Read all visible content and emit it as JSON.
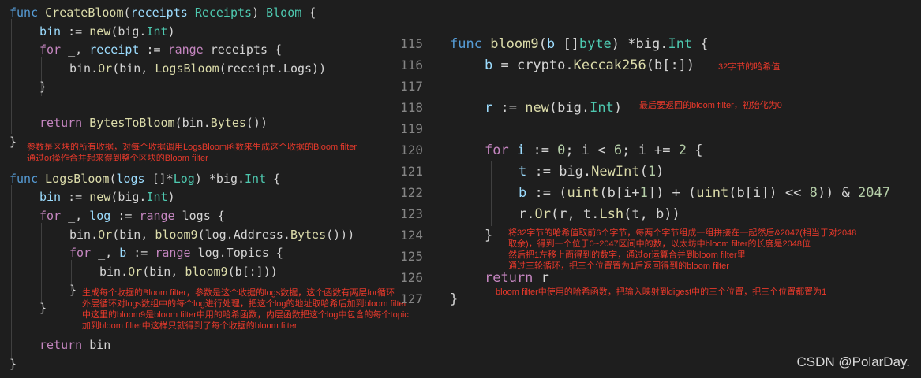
{
  "left_code": {
    "l1": {
      "kw": "func",
      "fn": "CreateBloom",
      "p1": "(",
      "vr": "receipts",
      "sp": " ",
      "ty": "Receipts",
      "p2": ") ",
      "ty2": "Bloom",
      "p3": " {"
    },
    "l2": {
      "vr": "bin",
      "op": " := ",
      "fn": "new",
      "p": "(big.",
      "ty": "Int",
      "end": ")"
    },
    "l3": {
      "ctl": "for",
      "a": " _, ",
      "vr": "receipt",
      "op": " := ",
      "ctl2": "range",
      "b": " receipts {"
    },
    "l4": {
      "a": "bin.",
      "fn": "Or",
      "b": "(bin, ",
      "fn2": "LogsBloom",
      "c": "(receipt.Logs))"
    },
    "l5": "}",
    "l6": {
      "ctl": "return",
      "sp": " ",
      "fn": "BytesToBloom",
      "a": "(bin.",
      "fn2": "Bytes",
      "b": "())"
    },
    "l7": "}",
    "l8": {
      "kw": "func",
      "fn": "LogsBloom",
      "p1": "(",
      "vr": "logs",
      "sp": " []*",
      "ty": "Log",
      "p2": ") *big.",
      "ty2": "Int",
      "p3": " {"
    },
    "l9": {
      "vr": "bin",
      "op": " := ",
      "fn": "new",
      "p": "(big.",
      "ty": "Int",
      "end": ")"
    },
    "l10": {
      "ctl": "for",
      "a": " _, ",
      "vr": "log",
      "op": " := ",
      "ctl2": "range",
      "b": " logs {"
    },
    "l11": {
      "a": "bin.",
      "fn": "Or",
      "b": "(bin, ",
      "fn2": "bloom9",
      "c": "(log.Address.",
      "fn3": "Bytes",
      "d": "()))"
    },
    "l12": {
      "ctl": "for",
      "a": " _, ",
      "vr": "b",
      "op": " := ",
      "ctl2": "range",
      "b": " log.Topics {"
    },
    "l13": {
      "a": "bin.",
      "fn": "Or",
      "b": "(bin, ",
      "fn2": "bloom9",
      "c": "(b[:]))"
    },
    "l14": "}",
    "l15": "}",
    "l16": {
      "ctl": "return",
      "b": " bin"
    },
    "l17": "}"
  },
  "right_code": {
    "line_numbers": [
      "115",
      "116",
      "117",
      "118",
      "119",
      "120",
      "121",
      "122",
      "123",
      "124",
      "125",
      "126",
      "127"
    ],
    "r1": {
      "kw": "func",
      "fn": "bloom9",
      "p1": "(",
      "vr": "b",
      "p2": " []",
      "ty": "byte",
      "p3": ") *big.",
      "ty2": "Int",
      "p4": " {"
    },
    "r2": {
      "vr": "b",
      "op": " = crypto.",
      "fn": "Keccak256",
      "a": "(b[:])"
    },
    "r3": {
      "vr": "r",
      "op": " := ",
      "fn": "new",
      "p": "(big.",
      "ty": "Int",
      "end": ")"
    },
    "r4": {
      "ctl": "for",
      "a": " ",
      "vr": "i",
      "op": " := ",
      "n1": "0",
      "b": "; i < ",
      "n2": "6",
      "c": "; i += ",
      "n3": "2",
      "d": " {"
    },
    "r5": {
      "vr": "t",
      "op": " := big.",
      "fn": "NewInt",
      "a": "(",
      "n": "1",
      "b": ")"
    },
    "r6": {
      "vr": "b",
      "op": " := (",
      "fn": "uint",
      "a": "(b[i+",
      "n1": "1",
      "b": "]) + (",
      "fn2": "uint",
      "c": "(b[i]) << ",
      "n2": "8",
      "d": ")) & ",
      "n3": "2047"
    },
    "r7": {
      "a": "r.",
      "fn": "Or",
      "b": "(r, t.",
      "fn2": "Lsh",
      "c": "(t, b))"
    },
    "r8": "}",
    "r9": {
      "ctl": "return",
      "b": " r"
    },
    "r10": "}"
  },
  "notes": {
    "n1": "参数是区块的所有收据，对每个收据调用LogsBloom函数来生成这个收据的Bloom filter\n通过or操作合并起来得到整个区块的Bloom filter",
    "n2": "生成每个收据的Bloom filter，参数是这个收据的logs数据，这个函数有两层for循环\n外层循环对logs数组中的每个log进行处理，把这个log的地址取哈希后加到bloom filter\n中这里的bloom9是bloom filter中用的哈希函数，内层函数把这个log中包含的每个topic\n加到bloom filter中这样只就得到了每个收据的bloom filter",
    "n3": "32字节的哈希值",
    "n4": "最后要返回的bloom filter，初始化为0",
    "n5": "将32字节的哈希值取前6个字节，每两个字节组成一组拼接在一起然后&2047(相当于对2048\n取余)，得到一个位于0~2047区间中的数，以太坊中bloom filter的长度是2048位\n然后把1左移上面得到的数字，通过or运算合并到bloom filter里\n通过三轮循环，把三个位置置为1后返回得到的bloom filter",
    "n6": "bloom filter中使用的哈希函数，把输入映射到digest中的三个位置，把三个位置都置为1"
  },
  "watermark": "CSDN @PolarDay."
}
